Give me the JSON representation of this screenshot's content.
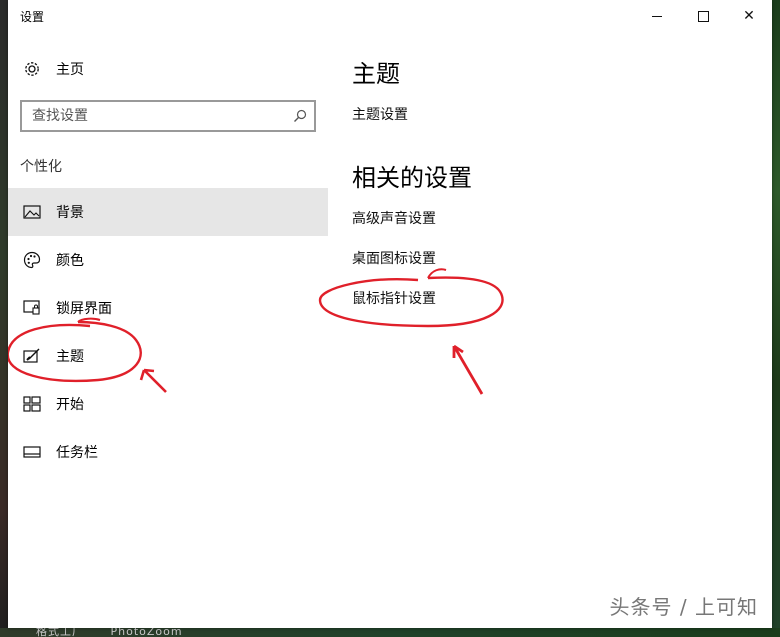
{
  "window": {
    "title": "设置",
    "controls": {
      "minimize": "minimize",
      "maximize": "maximize",
      "close": "✕"
    }
  },
  "sidebar": {
    "home_label": "主页",
    "search": {
      "placeholder": "查找设置",
      "value": ""
    },
    "section_label": "个性化",
    "items": [
      {
        "label": "背景",
        "icon": "picture-icon",
        "selected": true
      },
      {
        "label": "颜色",
        "icon": "palette-icon",
        "selected": false
      },
      {
        "label": "锁屏界面",
        "icon": "lock-screen-icon",
        "selected": false
      },
      {
        "label": "主题",
        "icon": "theme-brush-icon",
        "selected": false
      },
      {
        "label": "开始",
        "icon": "start-grid-icon",
        "selected": false
      },
      {
        "label": "任务栏",
        "icon": "taskbar-icon",
        "selected": false
      }
    ]
  },
  "main": {
    "title": "主题",
    "theme_settings_link": "主题设置",
    "related_title": "相关的设置",
    "related_links": [
      "高级声音设置",
      "桌面图标设置",
      "鼠标指针设置"
    ]
  },
  "watermark": "头条号 / 上可知",
  "taskbar": {
    "items": [
      "格式工厂",
      "PhotoZoom"
    ]
  },
  "colors": {
    "selected_bg": "#e6e6e6",
    "annotation_red": "#e0202a"
  }
}
